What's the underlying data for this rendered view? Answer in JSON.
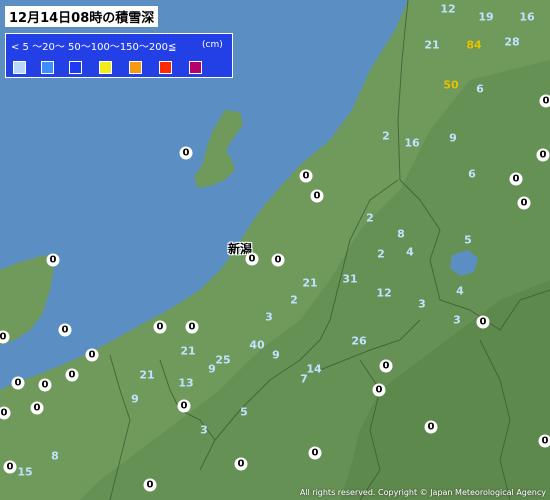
{
  "title": "12月14日08時の積雪深",
  "legend": {
    "scale_text": "< 5  ～20～  50～100～150～200≦",
    "unit": "(cm)",
    "colors": [
      "#b6d8ff",
      "#3c8dff",
      "#1e3af0",
      "#f2ec1a",
      "#f59a11",
      "#ff2a00",
      "#b4006b"
    ]
  },
  "city_label": "新潟",
  "copyright": "All rights reserved. Copyright © Japan Meteorological Agency",
  "observations": [
    {
      "value": "12",
      "cls": "c5"
    },
    {
      "value": "19",
      "cls": "c5"
    },
    {
      "value": "16",
      "cls": "c5"
    },
    {
      "value": "21",
      "cls": "c5"
    },
    {
      "value": "84",
      "cls": "c100"
    },
    {
      "value": "28",
      "cls": "c5"
    },
    {
      "value": "50",
      "cls": "c100"
    },
    {
      "value": "6",
      "cls": "c5"
    },
    {
      "value": "0",
      "cls": "zero"
    },
    {
      "value": "9",
      "cls": "c5"
    },
    {
      "value": "2",
      "cls": "c5"
    },
    {
      "value": "16",
      "cls": "c5"
    },
    {
      "value": "0",
      "cls": "zero"
    },
    {
      "value": "6",
      "cls": "c5"
    },
    {
      "value": "0",
      "cls": "zero"
    },
    {
      "value": "0",
      "cls": "zero"
    },
    {
      "value": "0",
      "cls": "zero"
    },
    {
      "value": "0",
      "cls": "zero"
    },
    {
      "value": "0",
      "cls": "zero"
    },
    {
      "value": "2",
      "cls": "c5"
    },
    {
      "value": "8",
      "cls": "c5"
    },
    {
      "value": "2",
      "cls": "c5"
    },
    {
      "value": "4",
      "cls": "c5"
    },
    {
      "value": "5",
      "cls": "c5"
    },
    {
      "value": "0",
      "cls": "zero"
    },
    {
      "value": "0",
      "cls": "zero"
    },
    {
      "value": "21",
      "cls": "c5"
    },
    {
      "value": "31",
      "cls": "c5"
    },
    {
      "value": "4",
      "cls": "c5"
    },
    {
      "value": "12",
      "cls": "c5"
    },
    {
      "value": "2",
      "cls": "c5"
    },
    {
      "value": "3",
      "cls": "c5"
    },
    {
      "value": "0",
      "cls": "zero"
    },
    {
      "value": "0",
      "cls": "zero"
    },
    {
      "value": "3",
      "cls": "c5"
    },
    {
      "value": "3",
      "cls": "c5"
    },
    {
      "value": "0",
      "cls": "zero"
    },
    {
      "value": "0",
      "cls": "zero"
    },
    {
      "value": "0",
      "cls": "zero"
    },
    {
      "value": "26",
      "cls": "c5"
    },
    {
      "value": "40",
      "cls": "c5"
    },
    {
      "value": "9",
      "cls": "c5"
    },
    {
      "value": "21",
      "cls": "c5"
    },
    {
      "value": "25",
      "cls": "c5"
    },
    {
      "value": "9",
      "cls": "c5"
    },
    {
      "value": "14",
      "cls": "c5"
    },
    {
      "value": "0",
      "cls": "zero"
    },
    {
      "value": "0",
      "cls": "zero"
    },
    {
      "value": "21",
      "cls": "c5"
    },
    {
      "value": "13",
      "cls": "c5"
    },
    {
      "value": "7",
      "cls": "c5"
    },
    {
      "value": "0",
      "cls": "zero"
    },
    {
      "value": "0",
      "cls": "zero"
    },
    {
      "value": "0",
      "cls": "zero"
    },
    {
      "value": "9",
      "cls": "c5"
    },
    {
      "value": "0",
      "cls": "zero"
    },
    {
      "value": "5",
      "cls": "c5"
    },
    {
      "value": "0",
      "cls": "zero"
    },
    {
      "value": "3",
      "cls": "c5"
    },
    {
      "value": "0",
      "cls": "zero"
    },
    {
      "value": "0",
      "cls": "zero"
    },
    {
      "value": "0",
      "cls": "zero"
    },
    {
      "value": "0",
      "cls": "zero"
    },
    {
      "value": "15",
      "cls": "c5"
    },
    {
      "value": "8",
      "cls": "c5"
    },
    {
      "value": "0",
      "cls": "zero"
    },
    {
      "value": "0",
      "cls": "zero"
    },
    {
      "value": "0",
      "cls": "zero"
    },
    {
      "value": "0",
      "cls": "zero"
    },
    {
      "value": "0",
      "cls": "zero"
    }
  ]
}
